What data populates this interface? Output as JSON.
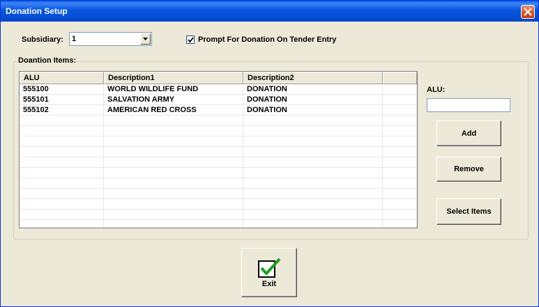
{
  "window": {
    "title": "Donation Setup",
    "close_icon": "close-x-icon"
  },
  "form": {
    "subsidiary_label": "Subsidiary:",
    "subsidiary_value": "1",
    "prompt_checkbox_label": "Prompt For Donation On Tender Entry",
    "prompt_checkbox_checked": true
  },
  "items": {
    "group_label": "Doantion Items:",
    "columns": [
      "ALU",
      "Description1",
      "Description2",
      ""
    ],
    "rows": [
      [
        "555100",
        "WORLD WILDLIFE FUND",
        "DONATION",
        ""
      ],
      [
        "555101",
        "SALVATION ARMY",
        "DONATION",
        ""
      ],
      [
        "555102",
        "AMERICAN RED CROSS",
        "DONATION",
        ""
      ]
    ]
  },
  "side": {
    "alu_label": "ALU:",
    "alu_value": "",
    "add_label": "Add",
    "remove_label": "Remove",
    "select_items_label": "Select Items"
  },
  "footer": {
    "exit_label": "Exit",
    "exit_icon": "checkmark-icon"
  },
  "colors": {
    "titlebar": "#0551d8",
    "face": "#ece9d8",
    "check_green": "#1e9e1e"
  }
}
